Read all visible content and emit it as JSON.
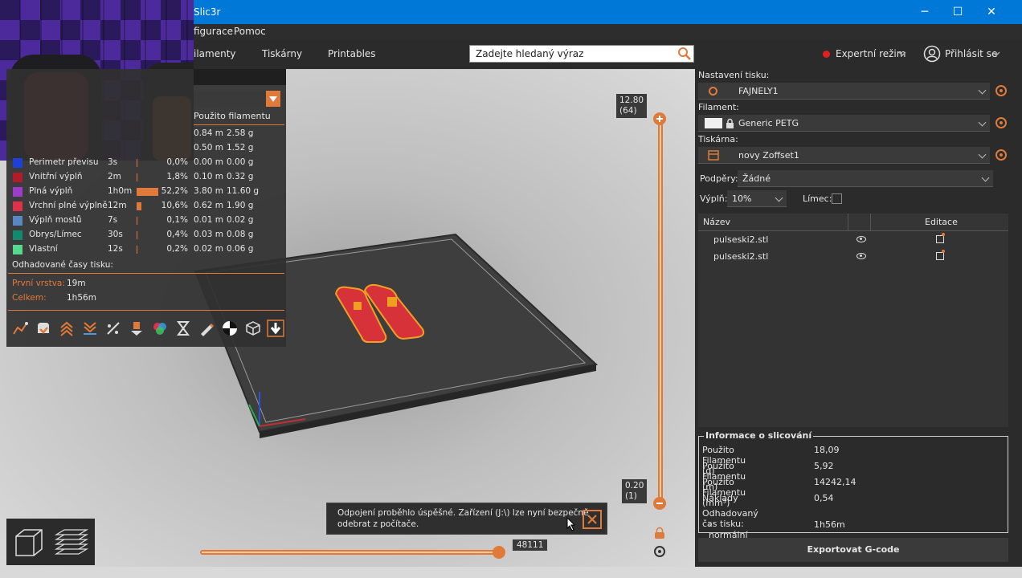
{
  "app": {
    "title": "Slic3r"
  },
  "menu": {
    "items": [
      "figurace",
      "Pomoc"
    ]
  },
  "tabs": {
    "items": [
      "ilamenty",
      "Tiskárny",
      "Printables"
    ]
  },
  "search": {
    "placeholder": "Zadejte hledaný výraz"
  },
  "header": {
    "mode_label": "Expertní režim",
    "login_label": "Přihlásit se"
  },
  "legend": {
    "usage_header": "Použito filamentu",
    "partial_rows": [
      {
        "meters": "0.84 m",
        "grams": "2.58 g"
      },
      {
        "meters": "0.50 m",
        "grams": "1.52 g"
      }
    ],
    "rows": [
      {
        "name": "Perimetr převisu",
        "time": "3s",
        "percent": "0,0%",
        "meters": "0.00 m",
        "grams": "0.00 g",
        "share": 0.0,
        "color": "#1f3fd6"
      },
      {
        "name": "Vnitřní výplň",
        "time": "2m",
        "percent": "1,8%",
        "meters": "0.10 m",
        "grams": "0.32 g",
        "share": 0.018,
        "color": "#b21c2a"
      },
      {
        "name": "Plná výplň",
        "time": "1h0m",
        "percent": "52,2%",
        "meters": "3.80 m",
        "grams": "11.60 g",
        "share": 0.522,
        "color": "#9b3ec9"
      },
      {
        "name": "Vrchní plné výplně",
        "time": "12m",
        "percent": "10,6%",
        "meters": "0.62 m",
        "grams": "1.90 g",
        "share": 0.106,
        "color": "#e0304a"
      },
      {
        "name": "Výplň mostů",
        "time": "7s",
        "percent": "0,1%",
        "meters": "0.01 m",
        "grams": "0.02 g",
        "share": 0.001,
        "color": "#5a86c4"
      },
      {
        "name": "Obrys/Límec",
        "time": "30s",
        "percent": "0,4%",
        "meters": "0.03 m",
        "grams": "0.08 g",
        "share": 0.004,
        "color": "#128a6e"
      },
      {
        "name": "Vlastní",
        "time": "12s",
        "percent": "0,2%",
        "meters": "0.02 m",
        "grams": "0.06 g",
        "share": 0.002,
        "color": "#55d98a"
      }
    ],
    "estimated_times_header": "Odhadované časy tisku:",
    "first_layer_label": "První vrstva:",
    "first_layer_value": "19m",
    "total_label": "Celkem:",
    "total_value": "1h56m",
    "toolbar_icons": [
      "travel-icon",
      "wipe-icon",
      "retractions-icon",
      "deretractions-icon",
      "seams-icon",
      "tool-changes-icon",
      "color-changes-icon",
      "pause-prints-icon",
      "custom-gcodes-icon",
      "center-of-gravity-icon",
      "shells-icon",
      "tool-marker-icon"
    ]
  },
  "vertical_slider": {
    "top_value": "12.80",
    "top_layer": "(64)",
    "bottom_value": "0.20",
    "bottom_layer": "(1)",
    "range_position": 1.0
  },
  "horizontal_slider": {
    "value": "48111",
    "position": 1.0
  },
  "toast": {
    "line1": "Odpojení proběhlo úspěšné. Zařízení (J:\\) lze nyní bezpečně",
    "line2": "odebrat z počítače."
  },
  "right_panel": {
    "print_settings_label": "Nastavení tisku:",
    "print_settings_value": "FAJNELY1",
    "filament_label": "Filament:",
    "filament_value": "Generic PETG",
    "printer_label": "Tiskárna:",
    "printer_value": "novy Zoffset1",
    "supports_label": "Podpěry:",
    "supports_value": "Žádné",
    "infill_label": "Výplň:",
    "infill_value": "10%",
    "brim_label": "Límec:",
    "brim_checked": false,
    "columns": {
      "name": "Název",
      "edit": "Editace"
    },
    "objects": [
      {
        "name": "pulseski2.stl"
      },
      {
        "name": "pulseski2.stl"
      }
    ],
    "slice_info_title": "Informace o slicování",
    "slice_info": [
      {
        "key": "Použito Filamentu (g)",
        "value": "18,09"
      },
      {
        "key": "Použito Filamentu (m)",
        "value": "5,92"
      },
      {
        "key": "Použito Filamentu (mm³)",
        "value": "14242,14"
      },
      {
        "key": "Náklady",
        "value": "0,54"
      },
      {
        "key": "Odhadovaný čas tisku:",
        "value": ""
      },
      {
        "key": "- normální režim",
        "value": "1h56m"
      }
    ],
    "export_label": "Exportovat G-code"
  },
  "colors": {
    "accent": "#e07a3a",
    "title_bar": "#0078d7",
    "panel": "#2b2b2b"
  }
}
